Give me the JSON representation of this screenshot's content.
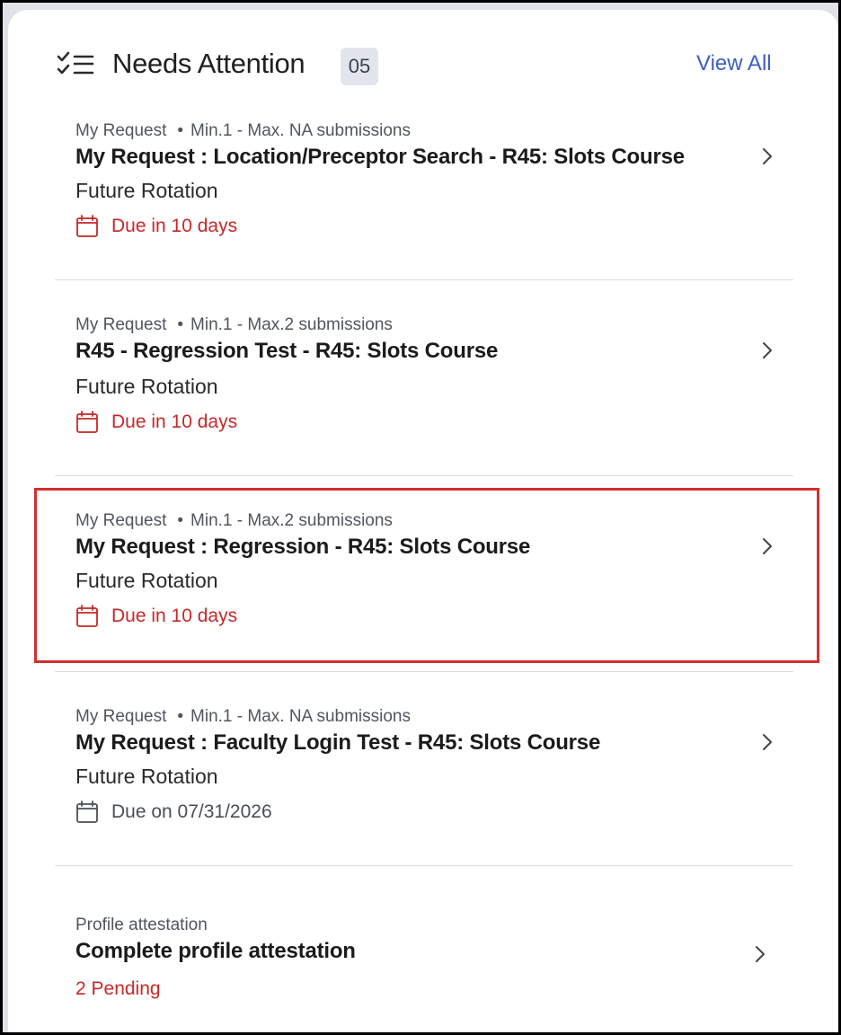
{
  "header": {
    "title": "Needs Attention",
    "count": "05",
    "view_all": "View All"
  },
  "items": [
    {
      "meta_type": "My Request",
      "meta_limits": "Min.1 - Max. NA submissions",
      "title": "My Request : Location/Preceptor Search - R45: Slots Course",
      "subtitle": "Future Rotation",
      "due": "Due in 10 days"
    },
    {
      "meta_type": "My Request",
      "meta_limits": "Min.1 - Max.2 submissions",
      "title": "R45 - Regression Test - R45: Slots Course",
      "subtitle": "Future Rotation",
      "due": "Due in 10 days"
    },
    {
      "meta_type": "My Request",
      "meta_limits": "Min.1 - Max.2 submissions",
      "title": "My Request : Regression - R45: Slots Course",
      "subtitle": "Future Rotation",
      "due": "Due in 10 days"
    },
    {
      "meta_type": "My Request",
      "meta_limits": "Min.1 - Max. NA submissions",
      "title": "My Request : Faculty Login Test - R45: Slots Course",
      "subtitle": "Future Rotation",
      "due": "Due on 07/31/2026"
    }
  ],
  "attestation": {
    "meta_type": "Profile attestation",
    "title": "Complete profile attestation",
    "pending": "2 Pending"
  },
  "colors": {
    "accent": "#3d5ec2",
    "urgent": "#c62828",
    "highlight_border": "#d32f2f"
  },
  "icons": {
    "header": "checklist-icon",
    "due": "calendar-icon",
    "row_action": "chevron-right-icon"
  }
}
